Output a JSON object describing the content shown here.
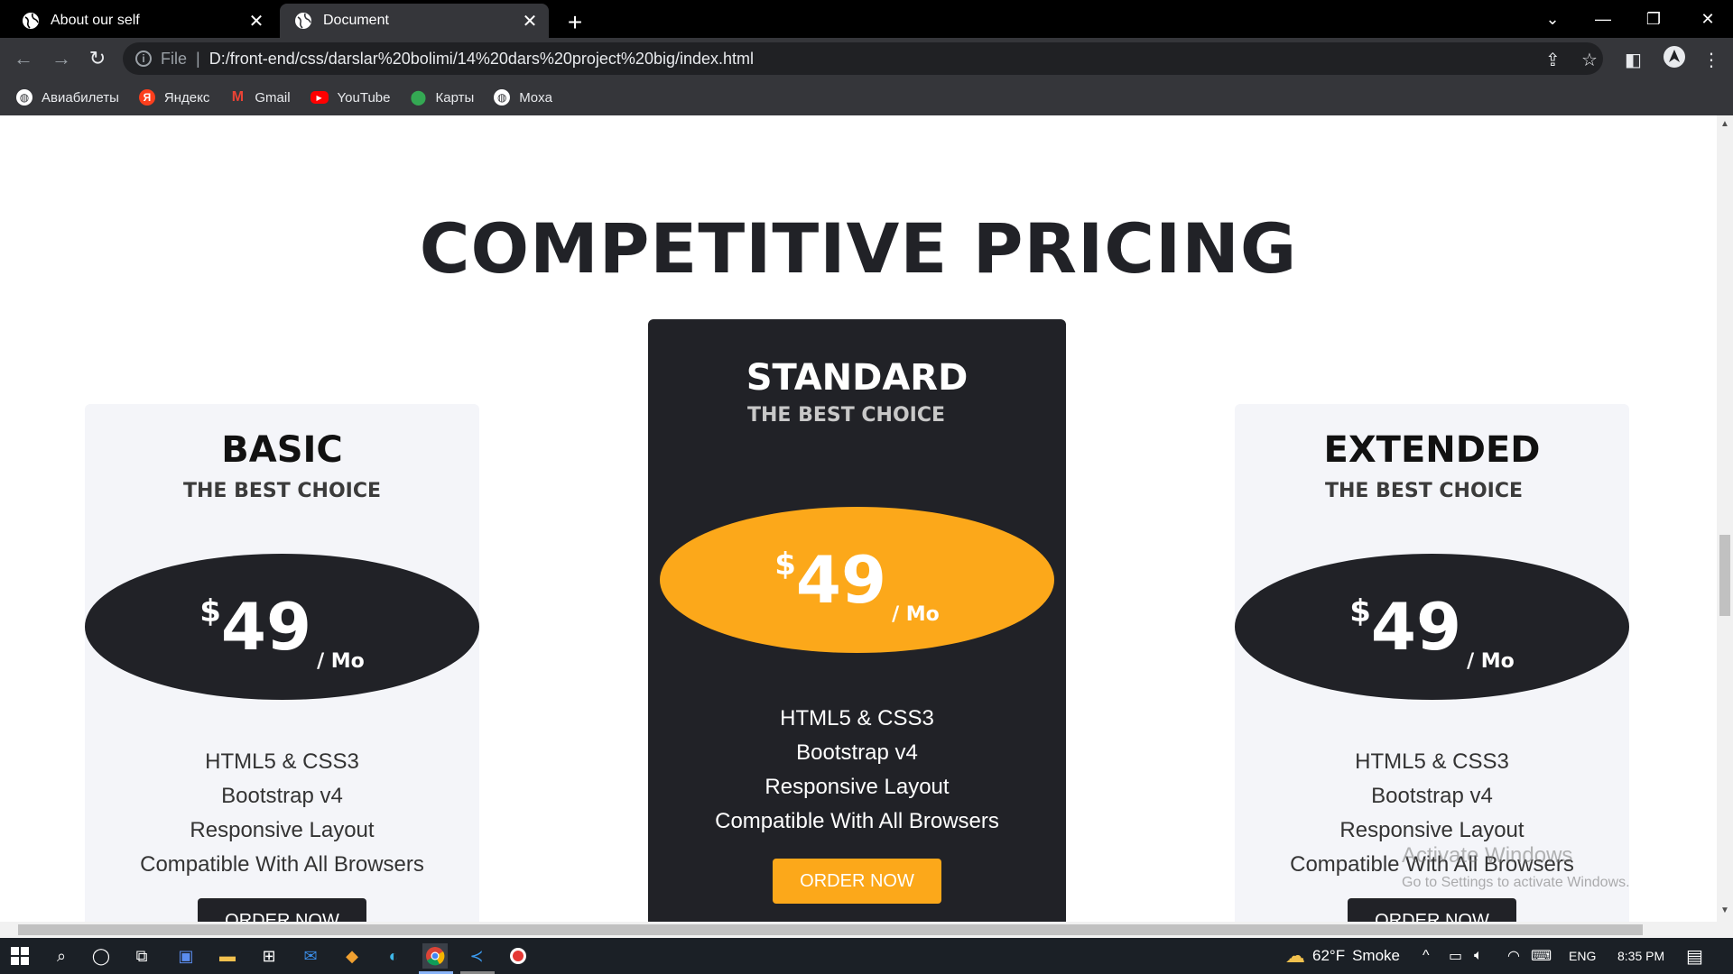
{
  "browser": {
    "tabs": [
      {
        "title": "About our self",
        "active": false
      },
      {
        "title": "Document",
        "active": true
      }
    ],
    "address": {
      "scheme_label": "File",
      "url": "D:/front-end/css/darslar%20bolimi/14%20dars%20project%20big/index.html"
    },
    "bookmarks": [
      {
        "label": "Авиабилеты",
        "icon": "globe-icon"
      },
      {
        "label": "Яндекс",
        "icon": "yandex-icon"
      },
      {
        "label": "Gmail",
        "icon": "gmail-icon"
      },
      {
        "label": "YouTube",
        "icon": "youtube-icon"
      },
      {
        "label": "Карты",
        "icon": "maps-pin-icon"
      },
      {
        "label": "Moxa",
        "icon": "globe-icon"
      }
    ]
  },
  "page": {
    "section_title": "COMPETITIVE PRICING",
    "plans": [
      {
        "name": "BASIC",
        "tagline": "THE BEST CHOICE",
        "currency": "$",
        "price": "49",
        "period": "/ Mo",
        "features": [
          "HTML5 & CSS3",
          "Bootstrap v4",
          "Responsive Layout",
          "Compatible With All Browsers"
        ],
        "button": "ORDER NOW"
      },
      {
        "name": "STANDARD",
        "tagline": "THE BEST CHOICE",
        "currency": "$",
        "price": "49",
        "period": "/ Mo",
        "features": [
          "HTML5 & CSS3",
          "Bootstrap v4",
          "Responsive Layout",
          "Compatible With All Browsers"
        ],
        "button": "ORDER NOW"
      },
      {
        "name": "EXTENDED",
        "tagline": "THE BEST CHOICE",
        "currency": "$",
        "price": "49",
        "period": "/ Mo",
        "features": [
          "HTML5 & CSS3",
          "Bootstrap v4",
          "Responsive Layout",
          "Compatible With All Browsers"
        ],
        "button": "ORDER NOW"
      }
    ],
    "watermark": {
      "line1": "Activate Windows",
      "line2": "Go to Settings to activate Windows."
    }
  },
  "taskbar": {
    "weather": {
      "temp": "62°F",
      "condition": "Smoke"
    },
    "language": "ENG",
    "time": "8:35 PM"
  },
  "colors": {
    "dark": "#212227",
    "gold": "#fca81a",
    "light_card": "#f4f5f9"
  }
}
